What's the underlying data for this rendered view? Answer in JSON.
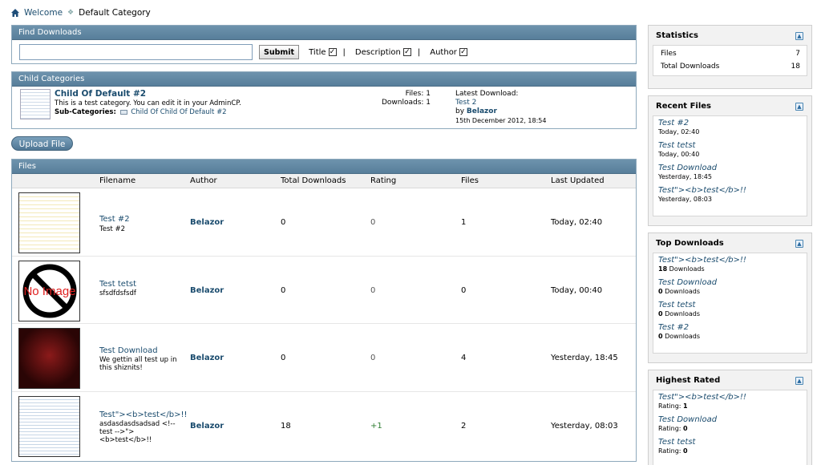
{
  "breadcrumb": {
    "home": "Welcome",
    "current": "Default Category"
  },
  "find": {
    "title": "Find Downloads",
    "submit_label": "Submit",
    "options": [
      "Title",
      "Description",
      "Author"
    ]
  },
  "child_categories": {
    "title": "Child Categories",
    "name": "Child Of Default #2",
    "description": "This is a test category. You can edit it in your AdminCP.",
    "sub_label": "Sub-Categories:",
    "sub_link": "Child Of Child Of Default #2",
    "files": "Files: 1",
    "downloads": "Downloads: 1",
    "latest_label": "Latest Download:",
    "latest_file": "Test 2",
    "by": "by",
    "latest_author": "Belazor",
    "latest_date": "15th December 2012, 18:54"
  },
  "upload_label": "Upload File",
  "files": {
    "title": "Files",
    "columns": [
      "Filename",
      "Author",
      "Total Downloads",
      "Rating",
      "Files",
      "Last Updated"
    ],
    "rows": [
      {
        "name": "Test #2",
        "desc": "Test #2",
        "author": "Belazor",
        "downloads": "0",
        "rating": "0",
        "files": "1",
        "updated": "Today, 02:40"
      },
      {
        "name": "Test tetst",
        "desc": "sfsdfdsfsdf",
        "author": "Belazor",
        "downloads": "0",
        "rating": "0",
        "files": "0",
        "updated": "Today, 00:40"
      },
      {
        "name": "Test Download",
        "desc": "We gettin all test up in this shiznits!",
        "author": "Belazor",
        "downloads": "0",
        "rating": "0",
        "files": "4",
        "updated": "Yesterday, 18:45"
      },
      {
        "name": "Test\"><b>test</b>!!",
        "desc": "asdasdasdsadsad <!-- test -->\"><b>test</b>!!",
        "author": "Belazor",
        "downloads": "18",
        "rating": "+1",
        "files": "2",
        "updated": "Yesterday, 08:03"
      }
    ],
    "noimage_text": "No Image"
  },
  "sidebar": {
    "statistics": {
      "title": "Statistics",
      "rows": [
        {
          "label": "Files",
          "value": "7"
        },
        {
          "label": "Total Downloads",
          "value": "18"
        }
      ]
    },
    "recent": {
      "title": "Recent Files",
      "items": [
        {
          "t": "Test #2",
          "s": "Today, 02:40"
        },
        {
          "t": "Test tetst",
          "s": "Today, 00:40"
        },
        {
          "t": "Test Download",
          "s": "Yesterday, 18:45"
        },
        {
          "t": "Test\"><b>test</b>!!",
          "s": "Yesterday, 08:03"
        }
      ]
    },
    "top": {
      "title": "Top Downloads",
      "items": [
        {
          "t": "Test\"><b>test</b>!!",
          "n": "18",
          "u": " Downloads"
        },
        {
          "t": "Test Download",
          "n": "0",
          "u": " Downloads"
        },
        {
          "t": "Test tetst",
          "n": "0",
          "u": " Downloads"
        },
        {
          "t": "Test #2",
          "n": "0",
          "u": " Downloads"
        }
      ]
    },
    "highest": {
      "title": "Highest Rated",
      "items": [
        {
          "t": "Test\"><b>test</b>!!",
          "l": "Rating: ",
          "n": "1"
        },
        {
          "t": "Test Download",
          "l": "Rating: ",
          "n": "0"
        },
        {
          "t": "Test tetst",
          "l": "Rating: ",
          "n": "0"
        }
      ]
    }
  }
}
